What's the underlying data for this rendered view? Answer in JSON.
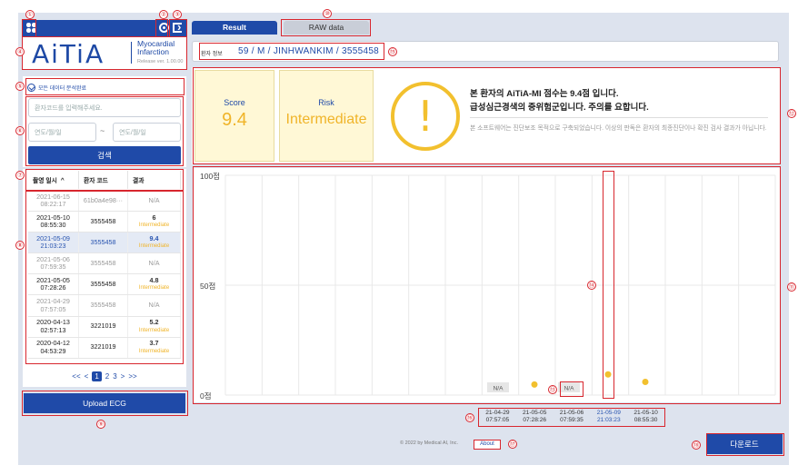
{
  "header": {
    "logo_text": "AiTiA",
    "product_line1": "Myocardial",
    "product_line2": "Infarction",
    "version": "Release ver. 1.00.00"
  },
  "sidebar": {
    "analysis_checkbox_label": "모든 데이터 분석완료",
    "patient_code_placeholder": "환자코드를 입력해주세요.",
    "date_from_placeholder": "연도/월/일",
    "date_sep": "~",
    "date_to_placeholder": "연도/월/일",
    "search_label": "검색",
    "table": {
      "columns": [
        "촬영 일시",
        "환자 코드",
        "결과"
      ],
      "sort_arrow": "^",
      "rows": [
        {
          "date": "2021-06-15",
          "time": "08:22:17",
          "code": "61b0a4e98···",
          "score": "",
          "level": "N/A",
          "state": "dim"
        },
        {
          "date": "2021-05-10",
          "time": "08:55:30",
          "code": "3555458",
          "score": "6",
          "level": "Intermediate",
          "state": "normal"
        },
        {
          "date": "2021-05-09",
          "time": "21:03:23",
          "code": "3555458",
          "score": "9.4",
          "level": "Intermediate",
          "state": "sel"
        },
        {
          "date": "2021-05-06",
          "time": "07:59:35",
          "code": "3555458",
          "score": "",
          "level": "N/A",
          "state": "dim"
        },
        {
          "date": "2021-05-05",
          "time": "07:28:26",
          "code": "3555458",
          "score": "4.8",
          "level": "Intermediate",
          "state": "normal"
        },
        {
          "date": "2021-04-29",
          "time": "07:57:05",
          "code": "3555458",
          "score": "",
          "level": "N/A",
          "state": "dim"
        },
        {
          "date": "2020-04-13",
          "time": "02:57:13",
          "code": "3221019",
          "score": "5.2",
          "level": "Intermediate",
          "state": "normal"
        },
        {
          "date": "2020-04-12",
          "time": "04:53:29",
          "code": "3221019",
          "score": "3.7",
          "level": "Intermediate",
          "state": "normal"
        }
      ]
    },
    "pager": {
      "prev2": "<<",
      "prev": "<",
      "pages": [
        "1",
        "2",
        "3"
      ],
      "next": ">",
      "next2": ">>"
    },
    "upload_label": "Upload ECG"
  },
  "tabs": {
    "result": "Result",
    "raw": "RAW data"
  },
  "patient": {
    "label": "환자 정보",
    "value": "59 / M / JINHWANKIM / 3555458"
  },
  "score_card": {
    "label": "Score",
    "value": "9.4"
  },
  "risk_card": {
    "label": "Risk",
    "value": "Intermediate"
  },
  "message": {
    "line1": "본 환자의 AiTiA-MI 점수는 9.4점 입니다.",
    "line2": "급성심근경색의 중위험군입니다. 주의를 요합니다.",
    "disclaimer": "본 소프트웨어는 진단보조 목적으로 구축되었습니다. 이상의 판독은 환자의 최종진단이나 확진 검사 결과가 아닙니다."
  },
  "chart_data": {
    "type": "scatter",
    "y_ticks": [
      "100점",
      "50점",
      "0점"
    ],
    "ylim": [
      0,
      100
    ],
    "grid": true,
    "points": [
      {
        "x": "21-04-29 07:57:05",
        "value": null,
        "label": "N/A"
      },
      {
        "x": "21-05-05 07:28:26",
        "value": 4.8,
        "label": ""
      },
      {
        "x": "21-05-06 07:59:35",
        "value": null,
        "label": "N/A"
      },
      {
        "x": "21-05-09 21:03:23",
        "value": 9.4,
        "label": "",
        "selected": true
      },
      {
        "x": "21-05-10 08:55:30",
        "value": 6,
        "label": ""
      }
    ],
    "point_color": "#f2c02e"
  },
  "dates": [
    {
      "d": "21-04-29",
      "t": "07:57:05"
    },
    {
      "d": "21-05-05",
      "t": "07:28:26"
    },
    {
      "d": "21-05-06",
      "t": "07:59:35"
    },
    {
      "d": "21-05-09",
      "t": "21:03:23"
    },
    {
      "d": "21-05-10",
      "t": "08:55:30"
    }
  ],
  "footer": {
    "copyright": "© 2022 by Medical AI, Inc.",
    "about": "About",
    "download": "다운로드"
  },
  "annotations": [
    "①",
    "②",
    "③",
    "④",
    "⑤",
    "⑥",
    "⑦",
    "⑧",
    "⑨",
    "⑩",
    "⑪",
    "⑫",
    "⑬",
    "⑭",
    "⑮",
    "⑯",
    "⑰",
    "⑱"
  ]
}
